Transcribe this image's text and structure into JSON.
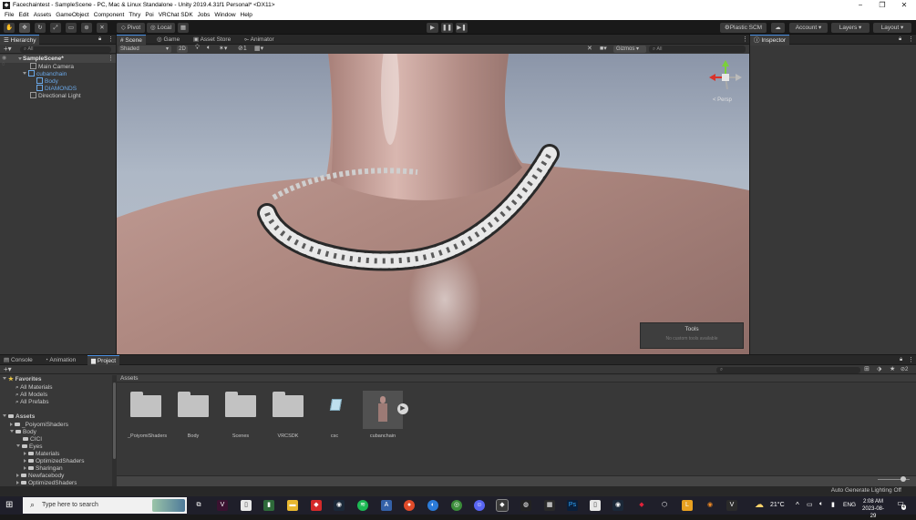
{
  "window": {
    "title": "Facechaintest - SampleScene - PC, Mac & Linux Standalone - Unity 2019.4.31f1 Personal* <DX11>",
    "app_icon": "unity-icon",
    "minimize": "−",
    "maximize": "❐",
    "close": "✕"
  },
  "menu": [
    "File",
    "Edit",
    "Assets",
    "GameObject",
    "Component",
    "Thry",
    "Poi",
    "VRChat SDK",
    "Jobs",
    "Window",
    "Help"
  ],
  "toolbar": {
    "pivot_label": "Pivot",
    "local_label": "Local",
    "plastic_scm_label": "Plastic SCM",
    "account_label": "Account",
    "layers_label": "Layers",
    "layout_label": "Layout"
  },
  "hierarchy": {
    "tab_label": "Hierarchy",
    "search_placeholder": "All",
    "scene_name": "SampleScene*",
    "items": [
      {
        "label": "Main Camera"
      },
      {
        "label": "cubanchain"
      },
      {
        "label": "Body"
      },
      {
        "label": "DIAMONDS"
      },
      {
        "label": "Directional Light"
      }
    ]
  },
  "scene_view": {
    "tabs": [
      "Scene",
      "Game",
      "Asset Store",
      "Animator"
    ],
    "shading_mode": "Shaded",
    "mode_2d": "2D",
    "gizmos_label": "Gizmos",
    "search_placeholder": "All",
    "persp_label": "< Persp",
    "tools_overlay": {
      "title": "Tools",
      "message": "No custom tools available"
    }
  },
  "inspector": {
    "tab_label": "Inspector"
  },
  "bottom": {
    "tabs": [
      "Console",
      "Animation",
      "Project"
    ],
    "favorites_label": "Favorites",
    "favorites": [
      "All Materials",
      "All Models",
      "All Prefabs"
    ],
    "assets_label": "Assets",
    "tree": [
      {
        "label": "_PoiyomiShaders"
      },
      {
        "label": "Body"
      },
      {
        "label": "CICI"
      },
      {
        "label": "Eyes"
      },
      {
        "label": "Materials"
      },
      {
        "label": "OptimizedShaders"
      },
      {
        "label": "Sharingan"
      },
      {
        "label": "Newfacebody"
      },
      {
        "label": "OptimizedShaders"
      }
    ],
    "breadcrumb": "Assets",
    "assets": [
      {
        "label": "_PoiyomiShaders",
        "kind": "folder"
      },
      {
        "label": "Body",
        "kind": "folder"
      },
      {
        "label": "Scenes",
        "kind": "folder"
      },
      {
        "label": "VRCSDK",
        "kind": "folder"
      },
      {
        "label": "csc",
        "kind": "file"
      },
      {
        "label": "cubanchain",
        "kind": "model"
      }
    ],
    "hidden_count": "2",
    "status": "Auto Generate Lighting Off"
  },
  "taskbar": {
    "search_placeholder": "Type here to search",
    "temperature": "21°C",
    "language": "ENG",
    "time": "2:08 AM",
    "date": "2023-08-29",
    "notifications": "4"
  },
  "colors": {
    "accent": "#4a90e2",
    "panel": "#383838",
    "scene_sky": "#aeb8c6"
  }
}
